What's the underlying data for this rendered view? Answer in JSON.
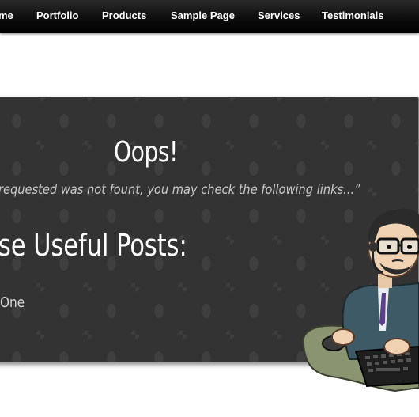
{
  "nav": {
    "items": [
      "me",
      "Portfolio",
      "Products",
      "Sample Page",
      "Services",
      "Testimonials"
    ]
  },
  "error": {
    "title": "Oops!",
    "message": "requested was not fount, you may check the following links...”"
  },
  "posts": {
    "heading": "se Useful Posts:",
    "items": [
      "One"
    ]
  },
  "icons": {
    "mascot": "programmer-at-keyboard-illustration"
  }
}
